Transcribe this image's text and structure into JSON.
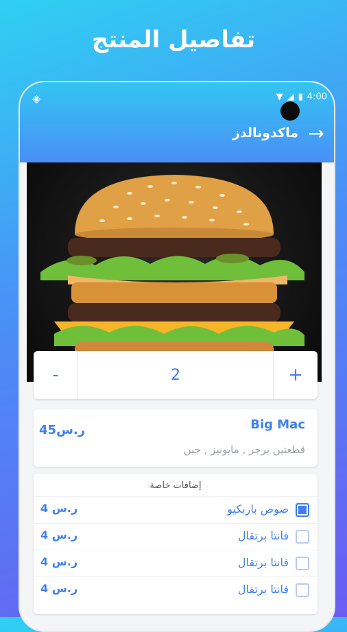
{
  "promo": {
    "title": "تفاصيل المنتج"
  },
  "status_bar": {
    "time": "4:00"
  },
  "header": {
    "title": "ماكدونالدز"
  },
  "quantity": {
    "minus_label": "-",
    "value": "2",
    "plus_label": "+"
  },
  "product": {
    "name": "Big Mac",
    "description": "قطعتين برجر , مايونيز , جبن",
    "price": "ر.س45"
  },
  "addons": {
    "title": "إضافات خاصة",
    "items": [
      {
        "name": "صوص باربكيو",
        "price": "ر.س 4",
        "checked": true
      },
      {
        "name": "فانتا برتقال",
        "price": "ر.س 4",
        "checked": false
      },
      {
        "name": "فانتا برتقال",
        "price": "ر.س 4",
        "checked": false
      },
      {
        "name": "فانتا برتقال",
        "price": "ر.س 4",
        "checked": false
      }
    ]
  },
  "colors": {
    "accent": "#3f7ff0",
    "header_top": "#33c5f2",
    "header_bottom": "#4a8ff6"
  }
}
